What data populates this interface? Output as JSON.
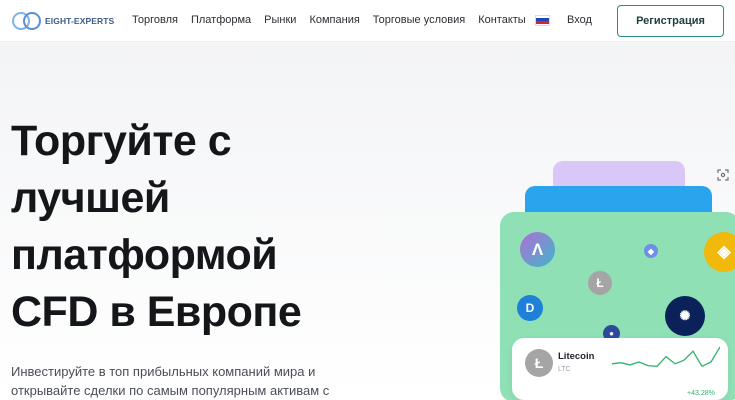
{
  "header": {
    "logo_text": "EIGHT-EXPERTS",
    "nav": [
      {
        "label": "Торговля"
      },
      {
        "label": "Платформа"
      },
      {
        "label": "Рынки"
      },
      {
        "label": "Компания"
      },
      {
        "label": "Торговые условия"
      },
      {
        "label": "Контакты"
      }
    ],
    "language_flag": "russia-flag-icon",
    "login_label": "Вход",
    "register_label": "Регистрация"
  },
  "hero": {
    "headline_lines": [
      "Торгуйте с",
      "лучшей",
      "платформой",
      "CFD в Европе"
    ],
    "subtext": "Инвестируйте в топ прибыльных компаний мира и открывайте сделки по самым популярным активам с"
  },
  "illustration": {
    "coins": [
      "aave-icon",
      "ethereum-icon",
      "binance-coin-icon",
      "litecoin-icon",
      "dash-icon",
      "cardano-icon",
      "coin-icon"
    ],
    "ticker": {
      "name": "Litecoin",
      "symbol": "LTC",
      "change": "+43.28%",
      "trend": [
        0.55,
        0.52,
        0.58,
        0.5,
        0.6,
        0.62,
        0.35,
        0.55,
        0.45,
        0.2,
        0.62,
        0.5,
        0.08
      ]
    }
  },
  "colors": {
    "accent": "#2a8c8a",
    "positive": "#2fb36c",
    "card_green": "#8fe0b4",
    "card_blue": "#2aa4ec",
    "card_purple": "#d9c8f7"
  }
}
